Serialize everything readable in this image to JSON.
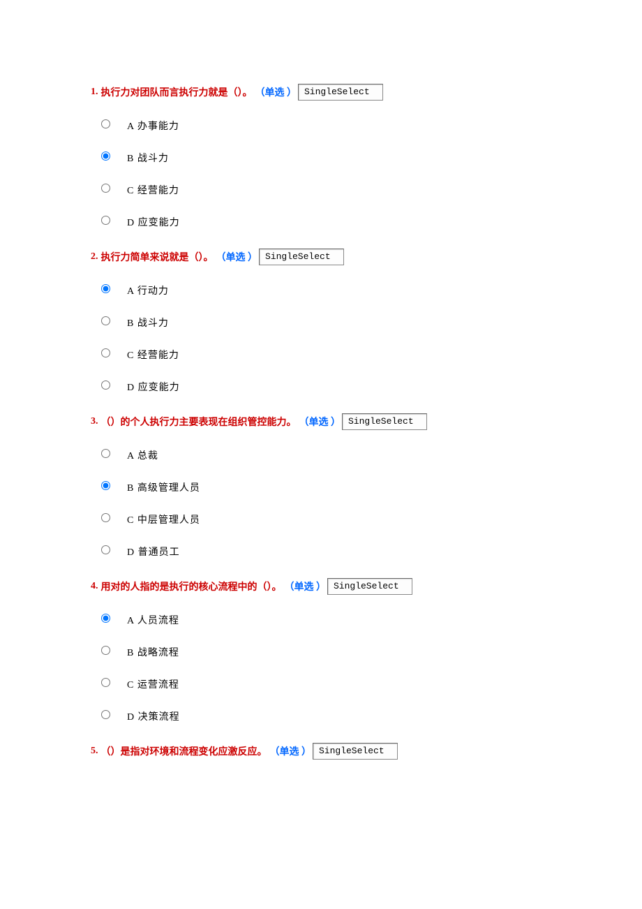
{
  "select_box_text": "SingleSelect",
  "type_label": "（单选 ）",
  "questions": [
    {
      "num": "1.",
      "text": "执行力对团队而言执行力就是（）。",
      "options": [
        {
          "label": "A 办事能力",
          "selected": false
        },
        {
          "label": "B 战斗力",
          "selected": true
        },
        {
          "label": "C 经营能力",
          "selected": false
        },
        {
          "label": "D 应变能力",
          "selected": false
        }
      ]
    },
    {
      "num": "2.",
      "text": "执行力简单来说就是（）。",
      "options": [
        {
          "label": "A 行动力",
          "selected": true
        },
        {
          "label": "B 战斗力",
          "selected": false
        },
        {
          "label": "C 经营能力",
          "selected": false
        },
        {
          "label": "D 应变能力",
          "selected": false
        }
      ]
    },
    {
      "num": "3.",
      "text": "（）的个人执行力主要表现在组织管控能力。",
      "options": [
        {
          "label": "A 总裁",
          "selected": false
        },
        {
          "label": "B 高级管理人员",
          "selected": true
        },
        {
          "label": "C 中层管理人员",
          "selected": false
        },
        {
          "label": "D 普通员工",
          "selected": false
        }
      ]
    },
    {
      "num": "4.",
      "text": "用对的人指的是执行的核心流程中的（）。",
      "options": [
        {
          "label": "A 人员流程",
          "selected": true
        },
        {
          "label": "B 战略流程",
          "selected": false
        },
        {
          "label": "C 运营流程",
          "selected": false
        },
        {
          "label": "D 决策流程",
          "selected": false
        }
      ]
    },
    {
      "num": "5.",
      "text": "（）是指对环境和流程变化应激反应。",
      "options": []
    }
  ]
}
